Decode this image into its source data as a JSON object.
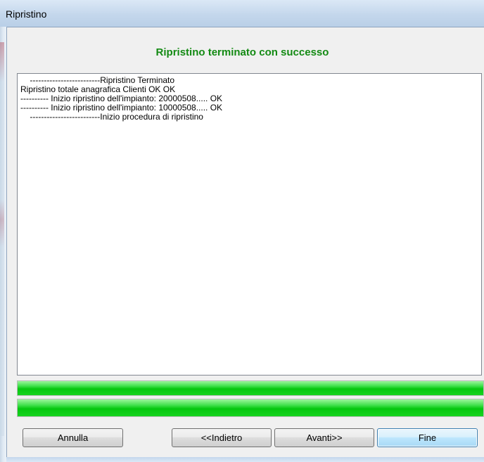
{
  "window": {
    "title": "Ripristino"
  },
  "header": {
    "heading": "Ripristino terminato con successo",
    "heading_color": "#138a13"
  },
  "log": {
    "lines": [
      "    -------------------------Ripristino Terminato",
      "Ripristino totale anagrafica Clienti OK OK",
      "---------- Inizio ripristino dell'impianto: 20000508..... OK",
      "---------- Inizio ripristino dell'impianto: 10000508..... OK",
      "    -------------------------Inizio procedura di ripristino"
    ]
  },
  "progress": {
    "bar1_fraction": 1.0,
    "bar2_fraction": 1.0,
    "fill_color": "#06c70f"
  },
  "buttons": {
    "cancel": "Annulla",
    "back": "<<Indietro",
    "next": "Avanti>>",
    "finish": "Fine"
  }
}
